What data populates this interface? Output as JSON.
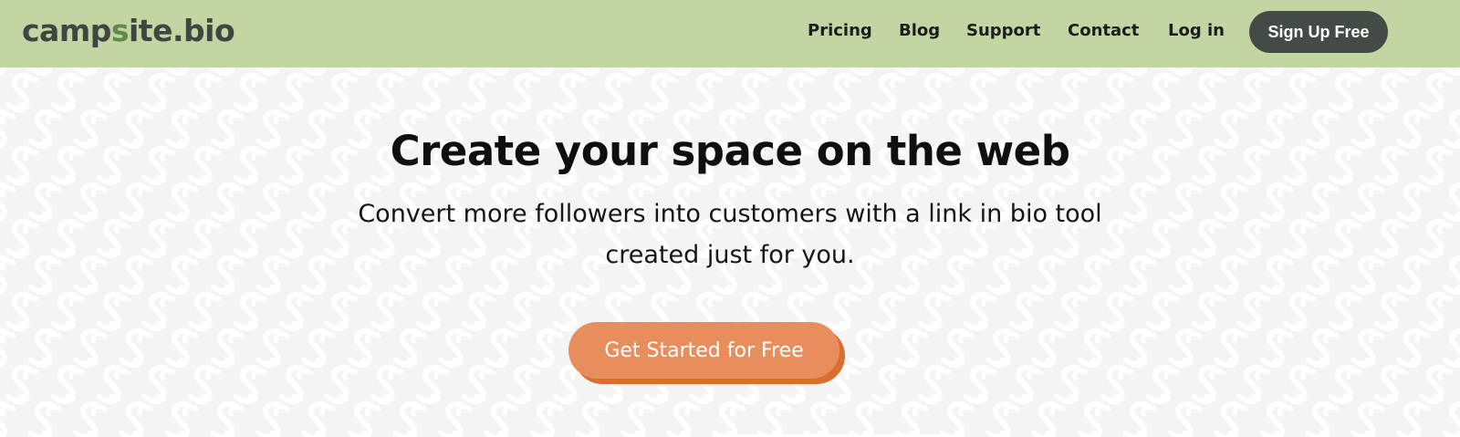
{
  "header": {
    "logo_prefix": "camp",
    "logo_s": "s",
    "logo_suffix": "ite.bio",
    "nav": [
      "Pricing",
      "Blog",
      "Support",
      "Contact",
      "Log in"
    ],
    "signup_label": "Sign Up Free"
  },
  "hero": {
    "headline": "Create your space on the web",
    "subline_1": "Convert more followers into customers with a link in bio tool",
    "subline_2": "created just for you.",
    "cta_label": "Get Started for Free"
  },
  "colors": {
    "header_bg": "#c3d5a2",
    "signup_bg": "#444a45",
    "cta_bg": "#e88e5d",
    "cta_shadow": "#d86e30",
    "page_bg": "#f4f4f4"
  },
  "icons": [
    "campsite-s-pattern-icon"
  ]
}
